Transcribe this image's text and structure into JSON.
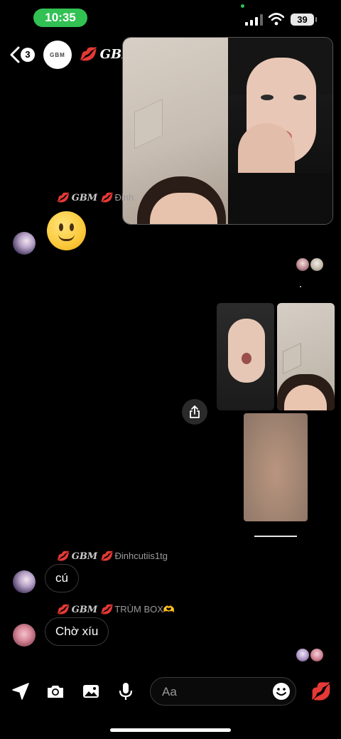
{
  "status_bar": {
    "time": "10:35",
    "battery": "39",
    "accent": "#32c153"
  },
  "header": {
    "back_count": "3",
    "group_avatar_text": "GBM",
    "title": "💋 GBM"
  },
  "messages": [
    {
      "sender_tag": "💋 GBM 💋",
      "sender_name": "Đinh",
      "content_type": "emoji",
      "content": "🙂"
    },
    {
      "sender_tag": "💋 GBM 💋",
      "sender_name": "Đinhcutiis1tg",
      "content_type": "text",
      "content": "cú"
    },
    {
      "sender_tag": "💋 GBM 💋",
      "sender_name": "TRÙM BOX🫶",
      "content_type": "text",
      "content": "Chờ xíu"
    }
  ],
  "composer": {
    "placeholder": "Aa",
    "send_reaction": "💋"
  },
  "colors": {
    "background": "#000000",
    "bubble_border": "#3a3a3a",
    "reaction_red": "#d21a2b"
  }
}
